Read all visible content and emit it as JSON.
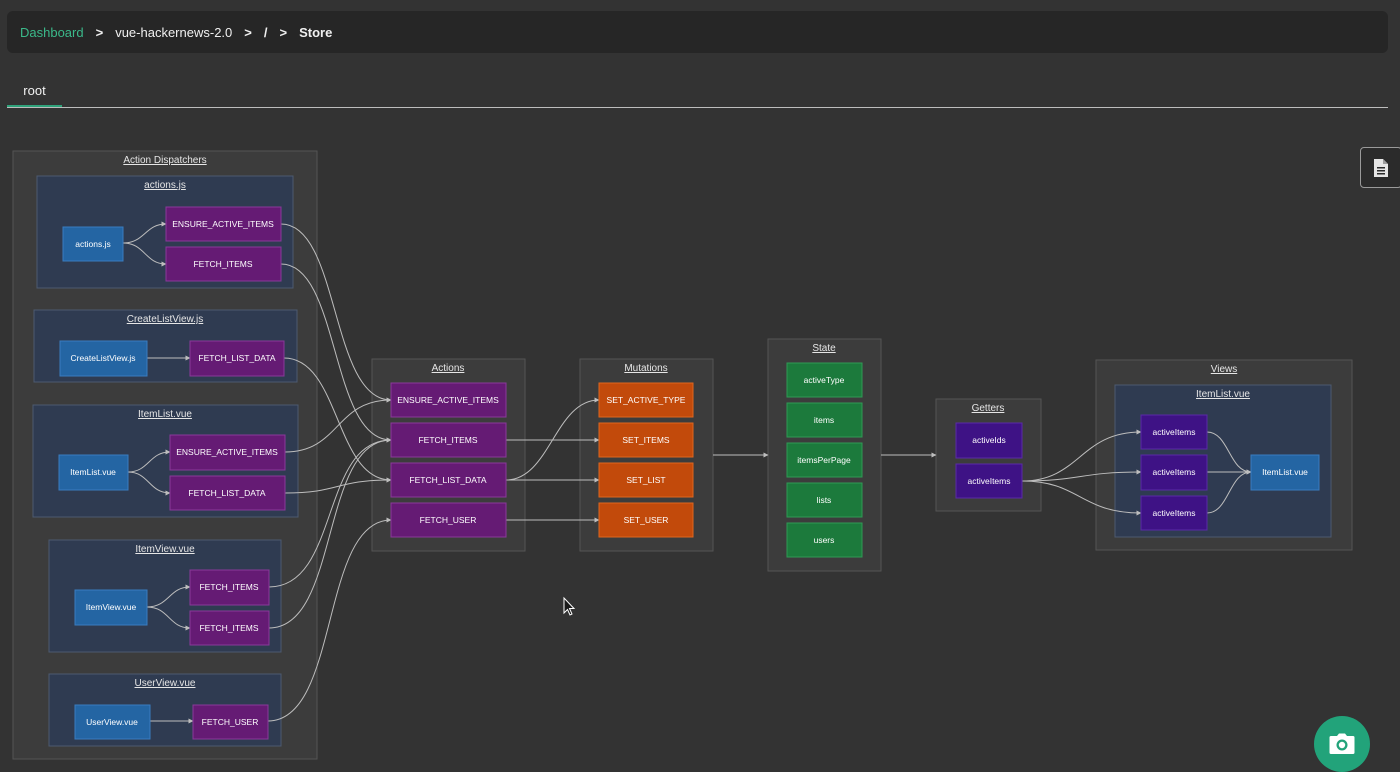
{
  "breadcrumb": {
    "dashboard": "Dashboard",
    "project": "vue-hackernews-2.0",
    "root": "/",
    "current": "Store",
    "separator": ">"
  },
  "tabs": [
    {
      "label": "root"
    }
  ],
  "icons": {
    "doc": "document-icon",
    "camera": "camera-icon",
    "cursor": "mouse-pointer-icon"
  },
  "colors": {
    "background": "#333333",
    "group": "#3c3c3c",
    "cluster": "#2f3b51",
    "source": "#2465a3",
    "action": "#651b74",
    "mutation": "#c24a0b",
    "state": "#1c7a3c",
    "getter": "#3e1285",
    "accent": "#22a37a"
  },
  "diagram": {
    "groups": {
      "dispatchers": "Action Dispatchers",
      "actions": "Actions",
      "mutations": "Mutations",
      "state": "State",
      "getters": "Getters",
      "views": "Views"
    },
    "clusters": {
      "actions_js": "actions.js",
      "create_list_view": "CreateListView.js",
      "item_list_vue": "ItemList.vue",
      "item_view_vue": "ItemView.vue",
      "user_view_vue": "UserView.vue",
      "views_item_list": "ItemList.vue"
    },
    "nodes": {
      "src_actions_js": "actions.js",
      "d_ensure_active_1": "ENSURE_ACTIVE_ITEMS",
      "d_fetch_items_1": "FETCH_ITEMS",
      "src_create_list_view": "CreateListView.js",
      "d_fetch_list_data_1": "FETCH_LIST_DATA",
      "src_item_list_vue": "ItemList.vue",
      "d_ensure_active_2": "ENSURE_ACTIVE_ITEMS",
      "d_fetch_list_data_2": "FETCH_LIST_DATA",
      "src_item_view_vue": "ItemView.vue",
      "d_fetch_items_2": "FETCH_ITEMS",
      "d_fetch_items_3": "FETCH_ITEMS",
      "src_user_view_vue": "UserView.vue",
      "d_fetch_user": "FETCH_USER",
      "a_ensure_active": "ENSURE_ACTIVE_ITEMS",
      "a_fetch_items": "FETCH_ITEMS",
      "a_fetch_list_data": "FETCH_LIST_DATA",
      "a_fetch_user": "FETCH_USER",
      "m_set_active_type": "SET_ACTIVE_TYPE",
      "m_set_items": "SET_ITEMS",
      "m_set_list": "SET_LIST",
      "m_set_user": "SET_USER",
      "s_active_type": "activeType",
      "s_items": "items",
      "s_items_per_page": "itemsPerPage",
      "s_lists": "lists",
      "s_users": "users",
      "g_active_ids": "activeIds",
      "g_active_items": "activeItems",
      "v_active_items_1": "activeItems",
      "v_active_items_2": "activeItems",
      "v_active_items_3": "activeItems",
      "v_item_list_vue": "ItemList.vue"
    }
  }
}
